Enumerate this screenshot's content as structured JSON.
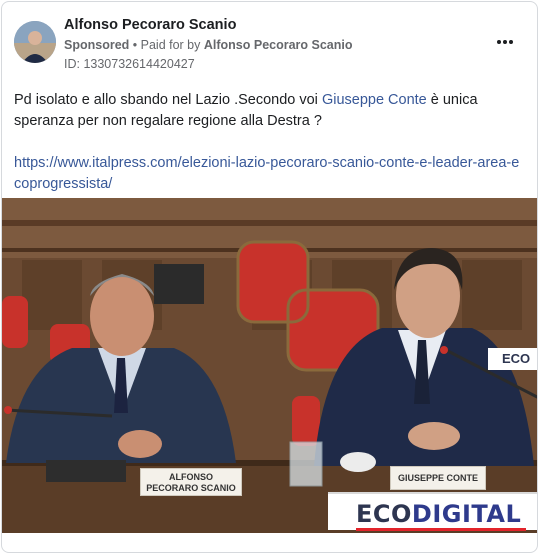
{
  "post": {
    "author": "Alfonso Pecoraro Scanio",
    "sponsored_label": "Sponsored",
    "separator": " • ",
    "paid_for_label": "Paid for by ",
    "paid_for_name": "Alfonso Pecoraro Scanio",
    "id_text": "ID: 1330732614420427",
    "more_icon": "more-horizontal-icon",
    "text_before_mention": "Pd isolato e allo sbando nel Lazio .Secondo voi ",
    "mention": "Giuseppe Conte",
    "text_after_mention": " è unica speranza per non regalare regione alla Destra ?",
    "link": "https://www.italpress.com/elezioni-lazio-pecoraro-scanio-conte-e-leader-area-ecoprogressista/"
  },
  "photo": {
    "placard_left_line1": "ALFONSO",
    "placard_left_line2": "PECORARO SCANIO",
    "placard_right": "GIUSEPPE CONTE",
    "banner_part1": "ECO",
    "banner_part2": "DIGITAL",
    "banner_small": "ECO"
  },
  "colors": {
    "link": "#385898",
    "secondary_text": "#65676b",
    "banner_red": "#e2242b"
  }
}
